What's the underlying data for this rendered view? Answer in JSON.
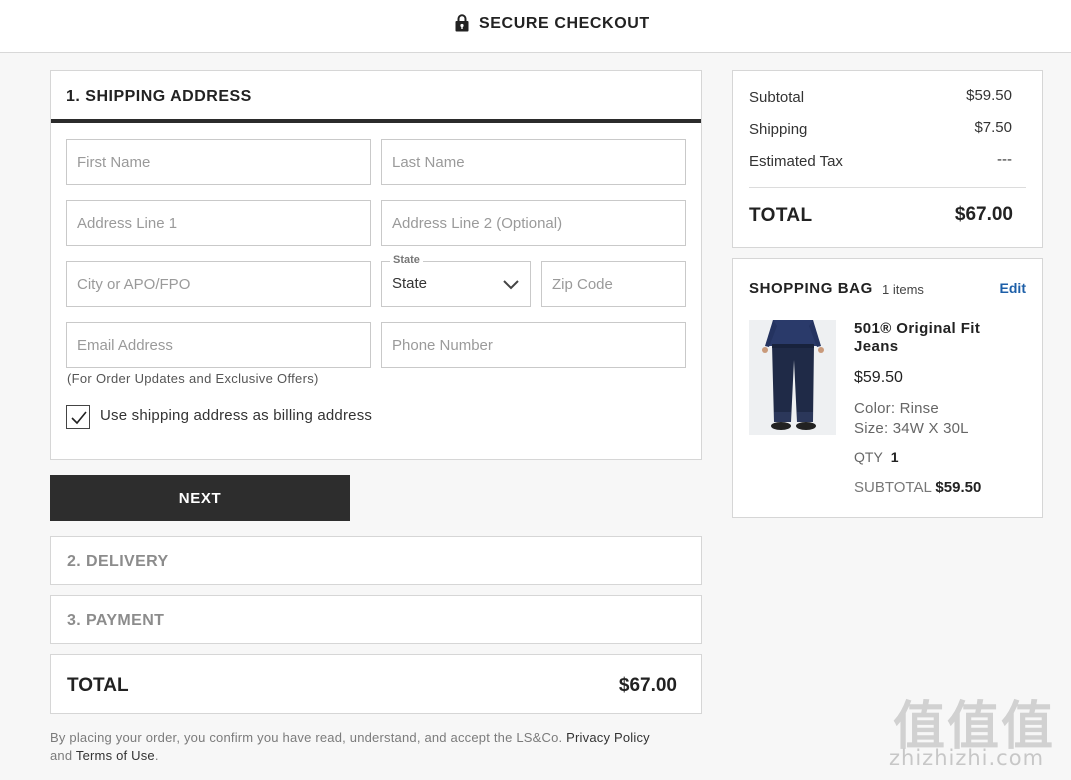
{
  "header": {
    "title": "SECURE CHECKOUT",
    "icon": "lock-icon"
  },
  "shipping": {
    "title": "1.  SHIPPING ADDRESS",
    "fields": {
      "first_name": {
        "placeholder": "First Name",
        "value": ""
      },
      "last_name": {
        "placeholder": "Last Name",
        "value": ""
      },
      "address1": {
        "placeholder": "Address Line 1",
        "value": ""
      },
      "address2": {
        "placeholder": "Address Line 2 (Optional)",
        "value": ""
      },
      "city": {
        "placeholder": "City or APO/FPO",
        "value": ""
      },
      "state": {
        "label": "State",
        "value": "State"
      },
      "zip": {
        "placeholder": "Zip Code",
        "value": ""
      },
      "email": {
        "placeholder": "Email Address",
        "value": ""
      },
      "phone": {
        "placeholder": "Phone Number",
        "value": ""
      }
    },
    "email_hint": "(For Order Updates and Exclusive Offers)",
    "billing_checkbox": {
      "label": "Use shipping address as billing address",
      "checked": true
    }
  },
  "next_button": "NEXT",
  "steps": [
    "2. DELIVERY",
    "3. PAYMENT"
  ],
  "total_bar": {
    "label": "TOTAL",
    "value": "$67.00"
  },
  "legal": {
    "prefix": "By placing your order, you confirm you have read, understand, and accept the LS&Co.",
    "privacy": "Privacy Policy",
    "and": "and",
    "terms": "Terms of Use",
    "suffix": "."
  },
  "summary": {
    "subtotal_label": "Subtotal",
    "subtotal_value": "$59.50",
    "shipping_label": "Shipping",
    "shipping_value": "$7.50",
    "tax_label": "Estimated Tax",
    "tax_value": "---",
    "total_label": "TOTAL",
    "total_value": "$67.00"
  },
  "bag": {
    "title": "SHOPPING BAG",
    "count": "1 items",
    "edit": "Edit",
    "item": {
      "name": "501® Original Fit Jeans",
      "price": "$59.50",
      "color": "Color: Rinse",
      "size": "Size: 34W X 30L",
      "qty_label": "QTY",
      "qty_value": "1",
      "subtotal_label": "SUBTOTAL",
      "subtotal_value": "$59.50"
    }
  },
  "watermark": {
    "chars": "值值值",
    "site": "zhizhizhi.com"
  },
  "colors": {
    "dark": "#2d2d2d",
    "link": "#1d5fa8",
    "border": "#d6d6d6"
  }
}
